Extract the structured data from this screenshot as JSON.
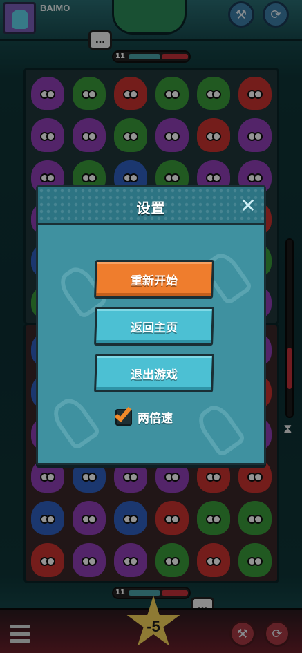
{
  "player": {
    "name": "BAIMO"
  },
  "top_meter": {
    "count": "11"
  },
  "bottom_meter": {
    "count": "11"
  },
  "chat_opp": "…",
  "chat_me": "…",
  "score_badge": "-5",
  "colors": {
    "red": "#c8322f",
    "green": "#3a9a3a",
    "purple": "#8f3fb5",
    "blue": "#2f5fbf"
  },
  "opponent_board": [
    [
      "purple",
      "green",
      "red",
      "green",
      "green",
      "red"
    ],
    [
      "purple",
      "purple",
      "green",
      "purple",
      "red",
      "purple"
    ],
    [
      "purple",
      "green",
      "blue",
      "green",
      "purple",
      "purple"
    ],
    [
      "purple",
      "blue",
      "green",
      "red",
      "green",
      "red"
    ],
    [
      "blue",
      "purple",
      "red",
      "green",
      "purple",
      "green"
    ],
    [
      "green",
      "blue",
      "purple",
      "green",
      "red",
      "purple"
    ]
  ],
  "my_board": [
    [
      "blue",
      "green",
      "red",
      "green",
      "blue",
      "purple"
    ],
    [
      "blue",
      "red",
      "purple",
      "green",
      "purple",
      "red"
    ],
    [
      "purple",
      "blue",
      "blue",
      "red",
      "green",
      "purple"
    ],
    [
      "purple",
      "blue",
      "purple",
      "purple",
      "red",
      "red"
    ],
    [
      "blue",
      "purple",
      "blue",
      "red",
      "green",
      "green"
    ],
    [
      "red",
      "purple",
      "purple",
      "green",
      "red",
      "green"
    ]
  ],
  "icons": {
    "hammer": "hammer-icon",
    "swap": "swap-icon",
    "close": "close-icon",
    "menu": "menu-icon",
    "hourglass": "hourglass-icon"
  },
  "settings": {
    "title": "设置",
    "restart_label": "重新开始",
    "home_label": "返回主页",
    "quit_label": "退出游戏",
    "double_speed_label": "两倍速",
    "double_speed_checked": true
  }
}
